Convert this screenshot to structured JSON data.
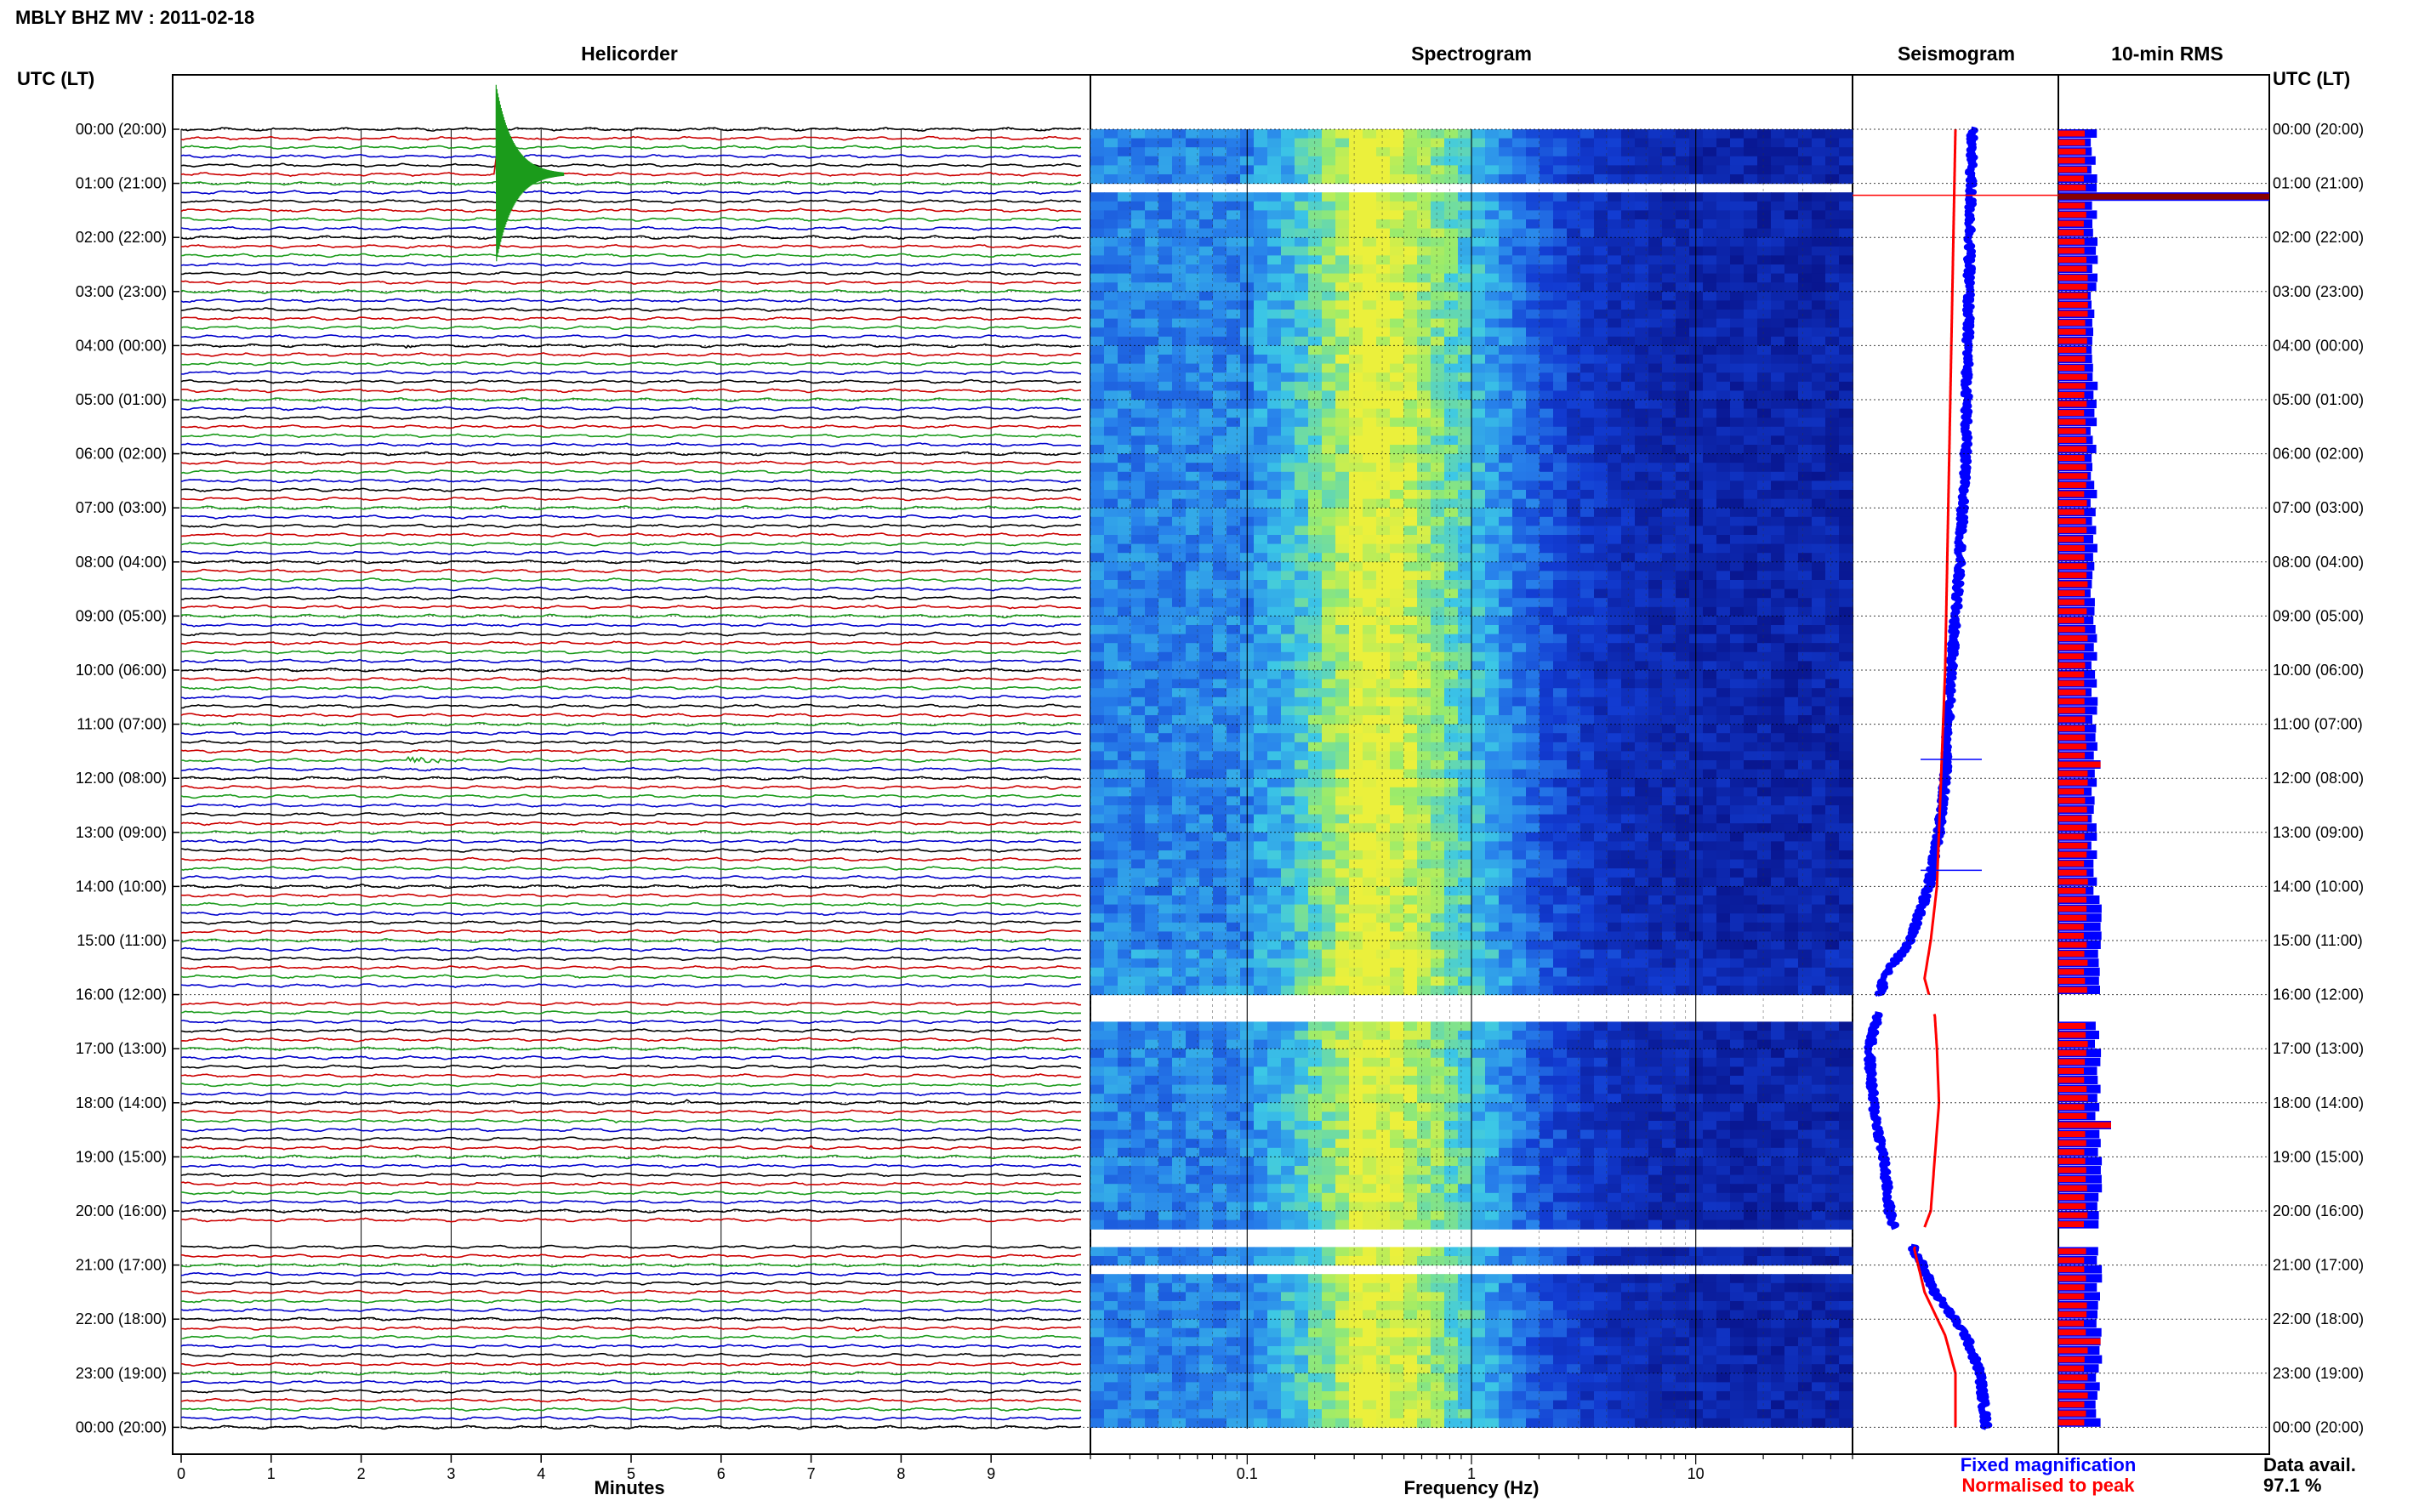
{
  "header": {
    "title": "MBLY BHZ MV : 2011-02-18",
    "time_axis_label": "UTC (LT)"
  },
  "panels": {
    "helicorder": "Helicorder",
    "spectrogram": "Spectrogram",
    "seismogram": "Seismogram",
    "rms": "10-min RMS"
  },
  "legend": {
    "fixed": "Fixed magnification",
    "normalised": "Normalised to peak",
    "fixed_color": "#0000ff",
    "normalised_color": "#ff0000"
  },
  "availability": {
    "label": "Data avail.",
    "value": "97.1 %"
  },
  "colors": {
    "trace_cycle": [
      "#000000",
      "#cc0000",
      "#1b9b1b",
      "#0000cc"
    ],
    "fixed": "#0000ff",
    "normalised": "#ff0000",
    "spectrogram_low": "#0a1e96",
    "spectrogram_mid": "#3ec8e6",
    "spectrogram_high": "#e6f03c"
  },
  "chart_data": [
    {
      "type": "line",
      "name": "helicorder",
      "title": "Helicorder",
      "xlabel": "Minutes",
      "x_ticks": [
        "0",
        "1",
        "2",
        "3",
        "4",
        "5",
        "6",
        "7",
        "8",
        "9"
      ],
      "xlim": [
        0,
        10
      ],
      "lines_per_hour": 6,
      "time_labels": [
        "00:00 (20:00)",
        "01:00 (21:00)",
        "02:00 (22:00)",
        "03:00 (23:00)",
        "04:00 (00:00)",
        "05:00 (01:00)",
        "06:00 (02:00)",
        "07:00 (03:00)",
        "08:00 (04:00)",
        "09:00 (05:00)",
        "10:00 (06:00)",
        "11:00 (07:00)",
        "12:00 (08:00)",
        "13:00 (09:00)",
        "14:00 (10:00)",
        "15:00 (11:00)",
        "16:00 (12:00)",
        "17:00 (13:00)",
        "18:00 (14:00)",
        "19:00 (15:00)",
        "20:00 (16:00)",
        "21:00 (17:00)",
        "22:00 (18:00)",
        "23:00 (19:00)",
        "00:00 (20:00)"
      ],
      "events": [
        {
          "hour": 0.83,
          "minute": 3.5,
          "amplitude": 5.5,
          "duration": 0.6,
          "color": "#1b9b1b"
        },
        {
          "hour": 3.95,
          "minute": 2.5,
          "amplitude": 0.4,
          "duration": 0.08,
          "color": "#000000"
        },
        {
          "hour": 11.67,
          "minute": 2.5,
          "amplitude": 0.5,
          "duration": 1.0,
          "color": "#0000cc"
        },
        {
          "hour": 13.95,
          "minute": 2.0,
          "amplitude": 0.4,
          "duration": 0.1,
          "color": "#0000cc"
        },
        {
          "hour": 14.95,
          "minute": 4.05,
          "amplitude": 0.3,
          "duration": 0.1,
          "color": "#0000cc"
        },
        {
          "hour": 18.3,
          "minute": 4.8,
          "amplitude": 0.3,
          "duration": 0.3,
          "color": "#0000cc"
        },
        {
          "hour": 18.0,
          "minute": 5.6,
          "amplitude": 0.3,
          "duration": 0.2,
          "color": "#1b9b1b"
        },
        {
          "hour": 18.5,
          "minute": 6.4,
          "amplitude": 0.3,
          "duration": 0.2,
          "color": "#1b9b1b"
        },
        {
          "hour": 18.8,
          "minute": 7.0,
          "amplitude": 0.3,
          "duration": 0.2,
          "color": "#cc0000"
        },
        {
          "hour": 19.65,
          "minute": 0.5,
          "amplitude": 0.3,
          "duration": 0.3,
          "color": "#000000"
        },
        {
          "hour": 20.0,
          "minute": 0.3,
          "amplitude": 0.3,
          "duration": 0.2,
          "color": "#000000"
        },
        {
          "hour": 22.1,
          "minute": 7.5,
          "amplitude": 0.3,
          "duration": 0.2,
          "color": "#cc0000"
        },
        {
          "hour": 23.0,
          "minute": 0.3,
          "amplitude": 0.2,
          "duration": 0.3,
          "color": "#0000cc"
        }
      ],
      "gaps_hours": [
        [
          16.0,
          16.2
        ],
        [
          20.3,
          20.6
        ]
      ]
    },
    {
      "type": "heatmap",
      "name": "spectrogram",
      "title": "Spectrogram",
      "xlabel": "Frequency (Hz)",
      "x_scale": "log",
      "xlim": [
        0.02,
        50
      ],
      "x_ticks": [
        0.1,
        1,
        10
      ],
      "x_tick_labels": [
        "0.1",
        "1",
        "10"
      ],
      "peak_frequency_hz": 0.3,
      "gaps_hours": [
        [
          1.0,
          1.15
        ],
        [
          16.0,
          16.4
        ],
        [
          20.3,
          20.6
        ],
        [
          21.0,
          21.1
        ],
        [
          21.3,
          21.35
        ]
      ]
    },
    {
      "type": "line",
      "name": "seismogram",
      "title": "Seismogram",
      "series": [
        {
          "name": "Fixed magnification",
          "color": "#0000ff",
          "hours": [
            0,
            2,
            4,
            6,
            8,
            10,
            12,
            13,
            14,
            15,
            15.7,
            16.4,
            17,
            18,
            19,
            20,
            20.3,
            20.7,
            21.5,
            22.3,
            23,
            24
          ],
          "values": [
            0.58,
            0.57,
            0.56,
            0.55,
            0.52,
            0.48,
            0.45,
            0.42,
            0.37,
            0.28,
            0.15,
            0.12,
            0.08,
            0.1,
            0.15,
            0.18,
            0.2,
            0.3,
            0.4,
            0.55,
            0.62,
            0.65
          ]
        },
        {
          "name": "Normalised to peak",
          "color": "#ff0000",
          "hours": [
            0,
            2,
            4,
            6,
            8,
            10,
            12,
            13,
            14,
            15,
            15.7,
            16.4,
            17,
            18,
            19,
            20,
            20.3,
            20.7,
            21.5,
            22.3,
            23,
            24
          ],
          "values": [
            0.5,
            0.49,
            0.48,
            0.47,
            0.46,
            0.45,
            0.43,
            0.42,
            0.41,
            0.38,
            0.35,
            0.4,
            0.41,
            0.42,
            0.4,
            0.38,
            0.35,
            0.3,
            0.35,
            0.45,
            0.5,
            0.5
          ]
        }
      ],
      "spikes": [
        {
          "hour": 1.22,
          "color": "#ff0000"
        },
        {
          "hour": 11.65,
          "color": "#0000ff"
        },
        {
          "hour": 13.7,
          "color": "#0000ff"
        }
      ]
    },
    {
      "type": "bar",
      "name": "rms",
      "title": "10-min RMS",
      "bins_per_hour": 6,
      "series": [
        {
          "name": "Fixed magnification",
          "color": "#0000ff",
          "base_value": 0.17
        },
        {
          "name": "Normalised to peak",
          "color": "#ff0000",
          "base_value": 0.13
        }
      ],
      "peaks": [
        {
          "hour": 1.2,
          "value": 1.0
        },
        {
          "hour": 11.6,
          "value": 0.2
        },
        {
          "hour": 18.4,
          "value": 0.25
        },
        {
          "hour": 22.3,
          "value": 0.2
        }
      ],
      "gaps_hours": [
        [
          16.0,
          16.4
        ],
        [
          20.3,
          20.6
        ]
      ]
    }
  ]
}
